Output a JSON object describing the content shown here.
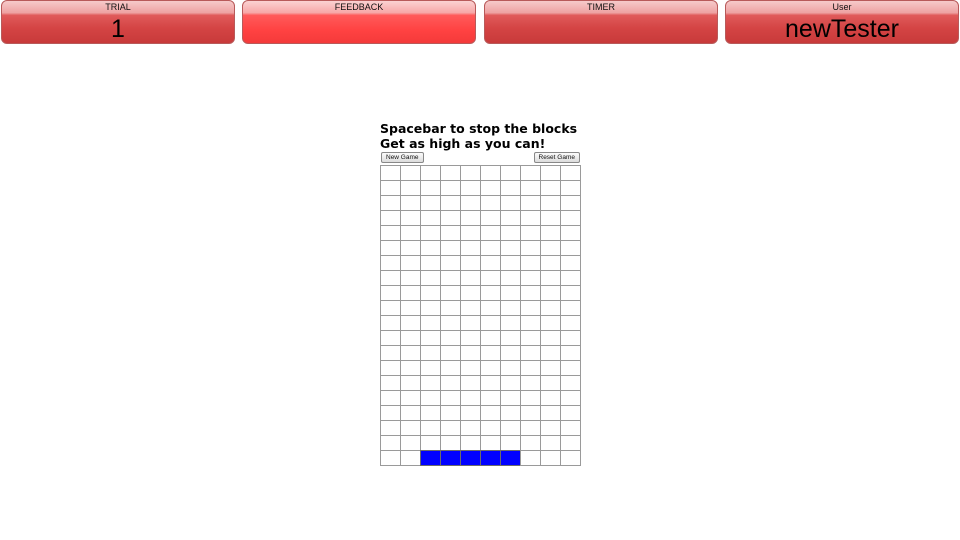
{
  "topbar": {
    "trial": {
      "title": "TRIAL",
      "value": "1"
    },
    "feedback": {
      "title": "FEEDBACK",
      "value": ""
    },
    "timer": {
      "title": "TIMER",
      "value": ""
    },
    "user": {
      "title": "User",
      "value": "newTester"
    }
  },
  "game": {
    "instruction_line1": "Spacebar to stop the blocks",
    "instruction_line2": "Get as high as you can!",
    "new_game_label": "New Game",
    "reset_game_label": "Reset Game",
    "board": {
      "columns": 10,
      "rows": 20,
      "filled_cells": [
        {
          "row": 20,
          "col": 3
        },
        {
          "row": 20,
          "col": 4
        },
        {
          "row": 20,
          "col": 5
        },
        {
          "row": 20,
          "col": 6
        },
        {
          "row": 20,
          "col": 7
        }
      ]
    },
    "block_color": "#0000ff"
  }
}
